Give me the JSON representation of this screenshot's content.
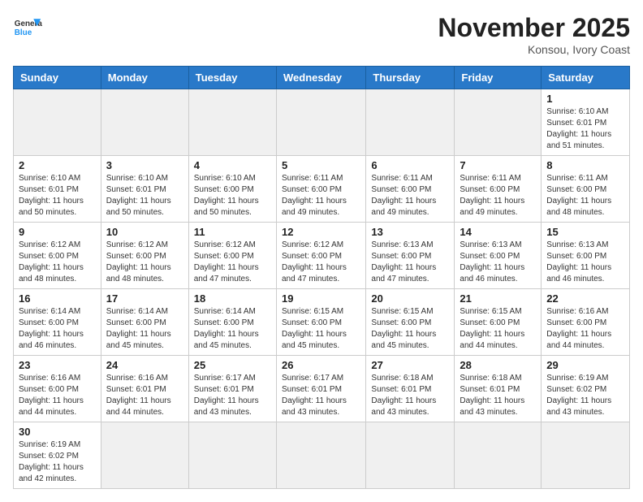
{
  "header": {
    "logo_general": "General",
    "logo_blue": "Blue",
    "month_title": "November 2025",
    "location": "Konsou, Ivory Coast"
  },
  "days_of_week": [
    "Sunday",
    "Monday",
    "Tuesday",
    "Wednesday",
    "Thursday",
    "Friday",
    "Saturday"
  ],
  "weeks": [
    [
      {
        "day": "",
        "info": "",
        "empty": true
      },
      {
        "day": "",
        "info": "",
        "empty": true
      },
      {
        "day": "",
        "info": "",
        "empty": true
      },
      {
        "day": "",
        "info": "",
        "empty": true
      },
      {
        "day": "",
        "info": "",
        "empty": true
      },
      {
        "day": "",
        "info": "",
        "empty": true
      },
      {
        "day": "1",
        "info": "Sunrise: 6:10 AM\nSunset: 6:01 PM\nDaylight: 11 hours\nand 51 minutes."
      }
    ],
    [
      {
        "day": "2",
        "info": "Sunrise: 6:10 AM\nSunset: 6:01 PM\nDaylight: 11 hours\nand 50 minutes."
      },
      {
        "day": "3",
        "info": "Sunrise: 6:10 AM\nSunset: 6:01 PM\nDaylight: 11 hours\nand 50 minutes."
      },
      {
        "day": "4",
        "info": "Sunrise: 6:10 AM\nSunset: 6:00 PM\nDaylight: 11 hours\nand 50 minutes."
      },
      {
        "day": "5",
        "info": "Sunrise: 6:11 AM\nSunset: 6:00 PM\nDaylight: 11 hours\nand 49 minutes."
      },
      {
        "day": "6",
        "info": "Sunrise: 6:11 AM\nSunset: 6:00 PM\nDaylight: 11 hours\nand 49 minutes."
      },
      {
        "day": "7",
        "info": "Sunrise: 6:11 AM\nSunset: 6:00 PM\nDaylight: 11 hours\nand 49 minutes."
      },
      {
        "day": "8",
        "info": "Sunrise: 6:11 AM\nSunset: 6:00 PM\nDaylight: 11 hours\nand 48 minutes."
      }
    ],
    [
      {
        "day": "9",
        "info": "Sunrise: 6:12 AM\nSunset: 6:00 PM\nDaylight: 11 hours\nand 48 minutes."
      },
      {
        "day": "10",
        "info": "Sunrise: 6:12 AM\nSunset: 6:00 PM\nDaylight: 11 hours\nand 48 minutes."
      },
      {
        "day": "11",
        "info": "Sunrise: 6:12 AM\nSunset: 6:00 PM\nDaylight: 11 hours\nand 47 minutes."
      },
      {
        "day": "12",
        "info": "Sunrise: 6:12 AM\nSunset: 6:00 PM\nDaylight: 11 hours\nand 47 minutes."
      },
      {
        "day": "13",
        "info": "Sunrise: 6:13 AM\nSunset: 6:00 PM\nDaylight: 11 hours\nand 47 minutes."
      },
      {
        "day": "14",
        "info": "Sunrise: 6:13 AM\nSunset: 6:00 PM\nDaylight: 11 hours\nand 46 minutes."
      },
      {
        "day": "15",
        "info": "Sunrise: 6:13 AM\nSunset: 6:00 PM\nDaylight: 11 hours\nand 46 minutes."
      }
    ],
    [
      {
        "day": "16",
        "info": "Sunrise: 6:14 AM\nSunset: 6:00 PM\nDaylight: 11 hours\nand 46 minutes."
      },
      {
        "day": "17",
        "info": "Sunrise: 6:14 AM\nSunset: 6:00 PM\nDaylight: 11 hours\nand 45 minutes."
      },
      {
        "day": "18",
        "info": "Sunrise: 6:14 AM\nSunset: 6:00 PM\nDaylight: 11 hours\nand 45 minutes."
      },
      {
        "day": "19",
        "info": "Sunrise: 6:15 AM\nSunset: 6:00 PM\nDaylight: 11 hours\nand 45 minutes."
      },
      {
        "day": "20",
        "info": "Sunrise: 6:15 AM\nSunset: 6:00 PM\nDaylight: 11 hours\nand 45 minutes."
      },
      {
        "day": "21",
        "info": "Sunrise: 6:15 AM\nSunset: 6:00 PM\nDaylight: 11 hours\nand 44 minutes."
      },
      {
        "day": "22",
        "info": "Sunrise: 6:16 AM\nSunset: 6:00 PM\nDaylight: 11 hours\nand 44 minutes."
      }
    ],
    [
      {
        "day": "23",
        "info": "Sunrise: 6:16 AM\nSunset: 6:00 PM\nDaylight: 11 hours\nand 44 minutes."
      },
      {
        "day": "24",
        "info": "Sunrise: 6:16 AM\nSunset: 6:01 PM\nDaylight: 11 hours\nand 44 minutes."
      },
      {
        "day": "25",
        "info": "Sunrise: 6:17 AM\nSunset: 6:01 PM\nDaylight: 11 hours\nand 43 minutes."
      },
      {
        "day": "26",
        "info": "Sunrise: 6:17 AM\nSunset: 6:01 PM\nDaylight: 11 hours\nand 43 minutes."
      },
      {
        "day": "27",
        "info": "Sunrise: 6:18 AM\nSunset: 6:01 PM\nDaylight: 11 hours\nand 43 minutes."
      },
      {
        "day": "28",
        "info": "Sunrise: 6:18 AM\nSunset: 6:01 PM\nDaylight: 11 hours\nand 43 minutes."
      },
      {
        "day": "29",
        "info": "Sunrise: 6:19 AM\nSunset: 6:02 PM\nDaylight: 11 hours\nand 43 minutes."
      }
    ],
    [
      {
        "day": "30",
        "info": "Sunrise: 6:19 AM\nSunset: 6:02 PM\nDaylight: 11 hours\nand 42 minutes."
      },
      {
        "day": "",
        "info": "",
        "empty": true
      },
      {
        "day": "",
        "info": "",
        "empty": true
      },
      {
        "day": "",
        "info": "",
        "empty": true
      },
      {
        "day": "",
        "info": "",
        "empty": true
      },
      {
        "day": "",
        "info": "",
        "empty": true
      },
      {
        "day": "",
        "info": "",
        "empty": true
      }
    ]
  ]
}
